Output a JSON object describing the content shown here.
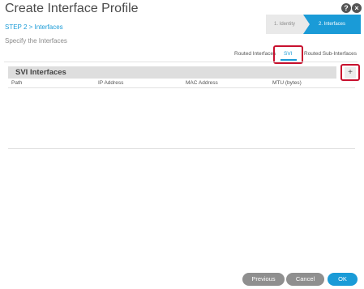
{
  "header": {
    "title": "Create Interface Profile",
    "help_icon": "?",
    "close_icon": "×"
  },
  "step": {
    "label": "STEP 2 > Interfaces",
    "subtitle": "Specify the Interfaces"
  },
  "wizard": {
    "steps": [
      {
        "label": "1. Identity",
        "state": "inactive"
      },
      {
        "label": "2. Interfaces",
        "state": "active"
      }
    ]
  },
  "tabs": [
    {
      "label": "Routed Interfaces",
      "selected": false
    },
    {
      "label": "SVI",
      "selected": true
    },
    {
      "label": "Routed Sub-Interfaces",
      "selected": false
    }
  ],
  "table": {
    "title": "SVI Interfaces",
    "add_icon": "+",
    "columns": [
      "Path",
      "IP Address",
      "MAC Address",
      "MTU (bytes)"
    ],
    "rows": []
  },
  "footer": {
    "previous_label": "Previous",
    "cancel_label": "Cancel",
    "ok_label": "OK"
  },
  "colors": {
    "accent": "#1a9bd7",
    "highlight": "#c8102e"
  }
}
